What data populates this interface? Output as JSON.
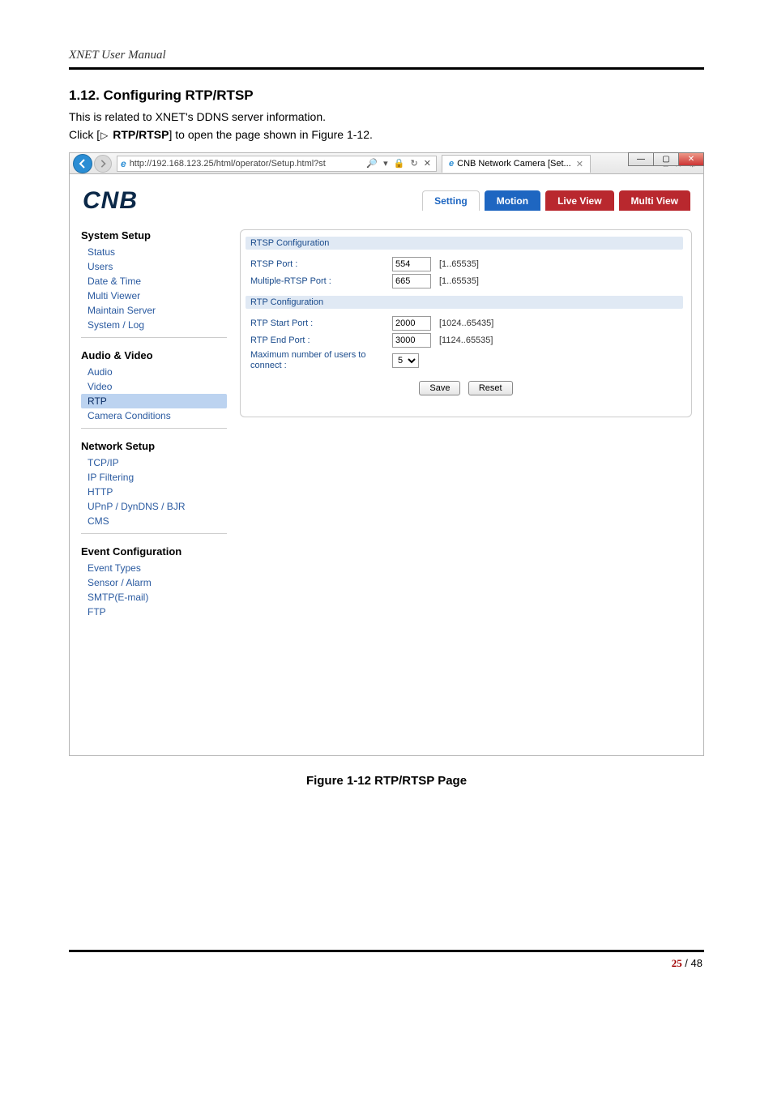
{
  "doc_header": "XNET User Manual",
  "section_title": "1.12. Configuring RTP/RTSP",
  "intro_text": "This is related to XNET's DDNS server information.",
  "click_prefix": "Click [",
  "click_bold": "RTP/RTSP",
  "click_suffix": "] to open the page shown in Figure 1-12.",
  "figure_caption": "Figure 1-12 RTP/RTSP Page",
  "page_number_current": "25",
  "page_number_sep": " / ",
  "page_number_total": "48",
  "browser": {
    "url": "http://192.168.123.25/html/operator/Setup.html?st",
    "tab_title": "CNB Network Camera [Set...",
    "logo_text": "CNB",
    "top_tabs": {
      "setting": "Setting",
      "motion": "Motion",
      "live": "Live View",
      "multi": "Multi View"
    },
    "sidebar": {
      "system_setup": {
        "head": "System Setup",
        "items": [
          "Status",
          "Users",
          "Date & Time",
          "Multi Viewer",
          "Maintain Server",
          "System / Log"
        ]
      },
      "audio_video": {
        "head": "Audio & Video",
        "items": [
          "Audio",
          "Video",
          "RTP",
          "Camera Conditions"
        ]
      },
      "network_setup": {
        "head": "Network Setup",
        "items": [
          "TCP/IP",
          "IP Filtering",
          "HTTP",
          "UPnP / DynDNS / BJR",
          "CMS"
        ]
      },
      "event_config": {
        "head": "Event Configuration",
        "items": [
          "Event Types",
          "Sensor / Alarm",
          "SMTP(E-mail)",
          "FTP"
        ]
      }
    },
    "panel": {
      "rtsp_group": "RTSP Configuration",
      "rtsp_port_label": "RTSP Port :",
      "rtsp_port_value": "554",
      "rtsp_port_range": "[1..65535]",
      "mrtsp_label": "Multiple-RTSP Port :",
      "mrtsp_value": "665",
      "mrtsp_range": "[1..65535]",
      "rtp_group": "RTP Configuration",
      "rtp_start_label": "RTP Start Port :",
      "rtp_start_value": "2000",
      "rtp_start_range": "[1024..65435]",
      "rtp_end_label": "RTP End Port :",
      "rtp_end_value": "3000",
      "rtp_end_range": "[1124..65535]",
      "max_users_label": "Maximum number of users to connect :",
      "max_users_value": "5",
      "save_btn": "Save",
      "reset_btn": "Reset"
    }
  }
}
